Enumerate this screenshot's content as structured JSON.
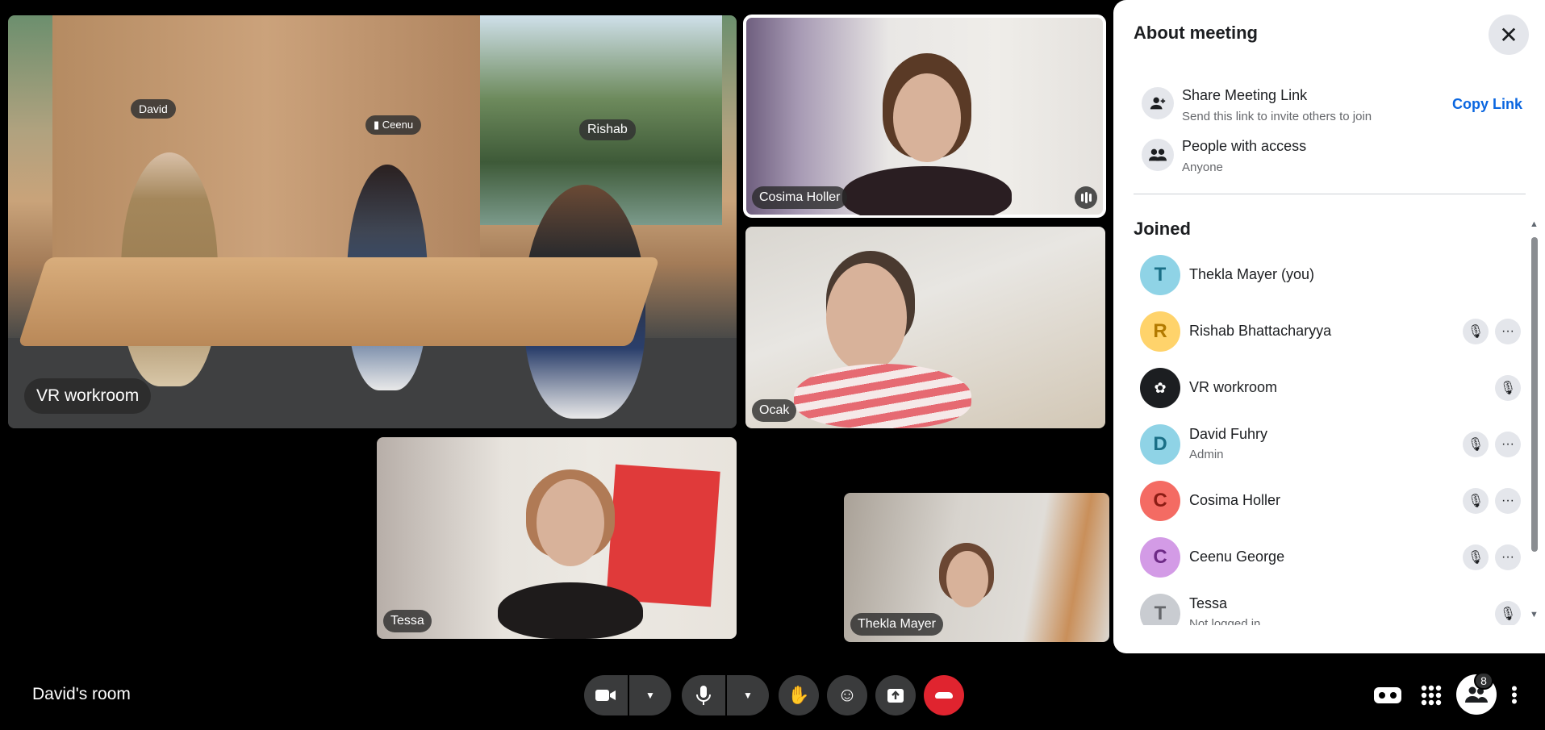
{
  "tiles": {
    "vr": {
      "label": "VR workroom",
      "tags": {
        "david": "David",
        "ceenu": "Ceenu",
        "rishab": "Rishab"
      }
    },
    "cosima": {
      "label": "Cosima Holler"
    },
    "ocak": {
      "label": "Ocak"
    },
    "tessa": {
      "label": "Tessa"
    },
    "thekla": {
      "label": "Thekla Mayer"
    }
  },
  "panel": {
    "title": "About meeting",
    "share": {
      "title": "Share Meeting Link",
      "subtitle": "Send this link to invite others to join",
      "action": "Copy Link"
    },
    "access": {
      "title": "People with access",
      "subtitle": "Anyone"
    },
    "joined_heading": "Joined",
    "participants": [
      {
        "initial": "T",
        "name": "Thekla Mayer (you)",
        "sub": "",
        "color": "#8fd3e6",
        "fg": "#1a6f86"
      },
      {
        "initial": "R",
        "name": "Rishab Bhattacharyya",
        "sub": "",
        "color": "#ffd36b",
        "fg": "#b37a00"
      },
      {
        "initial": "",
        "name": "VR workroom",
        "sub": "",
        "color": "#1c1e21",
        "fg": "#ffffff"
      },
      {
        "initial": "D",
        "name": "David Fuhry",
        "sub": "Admin",
        "color": "#8fd3e6",
        "fg": "#1a6f86"
      },
      {
        "initial": "C",
        "name": "Cosima Holler",
        "sub": "",
        "color": "#f46b63",
        "fg": "#8b1c14"
      },
      {
        "initial": "C",
        "name": "Ceenu George",
        "sub": "",
        "color": "#d39be6",
        "fg": "#6d2a86"
      },
      {
        "initial": "T",
        "name": "Tessa",
        "sub": "Not logged in",
        "color": "#c9ccd1",
        "fg": "#65676b"
      }
    ]
  },
  "bottom": {
    "room_name": "David's room",
    "people_count": "8"
  }
}
